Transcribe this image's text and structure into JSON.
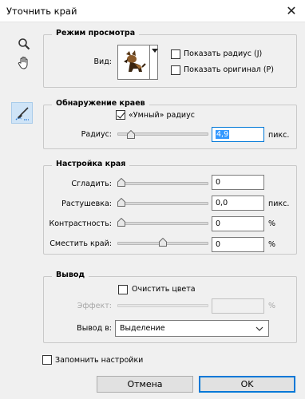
{
  "window": {
    "title": "Уточнить край",
    "close_glyph": "✕"
  },
  "tools": {
    "zoom": "zoom-icon",
    "hand": "hand-icon",
    "brush": "refine-radius-brush-icon"
  },
  "view_mode": {
    "title": "Режим просмотра",
    "view_label": "Вид:",
    "show_radius_label": "Показать радиус (J)",
    "show_radius_checked": false,
    "show_original_label": "Показать оригинал (P)",
    "show_original_checked": false
  },
  "edge_detection": {
    "title": "Обнаружение краев",
    "smart_radius_label": "«Умный» радиус",
    "smart_radius_checked": true,
    "radius_label": "Радиус:",
    "radius_value": "4,9",
    "radius_unit": "пикс.",
    "radius_slider": 0.12
  },
  "adjust_edge": {
    "title": "Настройка края",
    "rows": [
      {
        "label": "Сгладить:",
        "value": "0",
        "unit": "",
        "slider": 0.0
      },
      {
        "label": "Растушевка:",
        "value": "0,0",
        "unit": "пикс.",
        "slider": 0.0
      },
      {
        "label": "Контрастность:",
        "value": "0",
        "unit": "%",
        "slider": 0.0
      },
      {
        "label": "Сместить край:",
        "value": "0",
        "unit": "%",
        "slider": 0.5
      }
    ]
  },
  "output": {
    "title": "Вывод",
    "decontaminate_label": "Очистить цвета",
    "decontaminate_checked": false,
    "amount_label": "Эффект:",
    "amount_unit": "%",
    "amount_value": "",
    "output_to_label": "Вывод в:",
    "output_to_value": "Выделение"
  },
  "remember_label": "Запомнить настройки",
  "remember_checked": false,
  "buttons": {
    "cancel": "Отмена",
    "ok": "OK"
  },
  "colors": {
    "selection": "#3399ff",
    "default_button_border": "#0078d7",
    "active_tool": "#cfe4f7"
  }
}
